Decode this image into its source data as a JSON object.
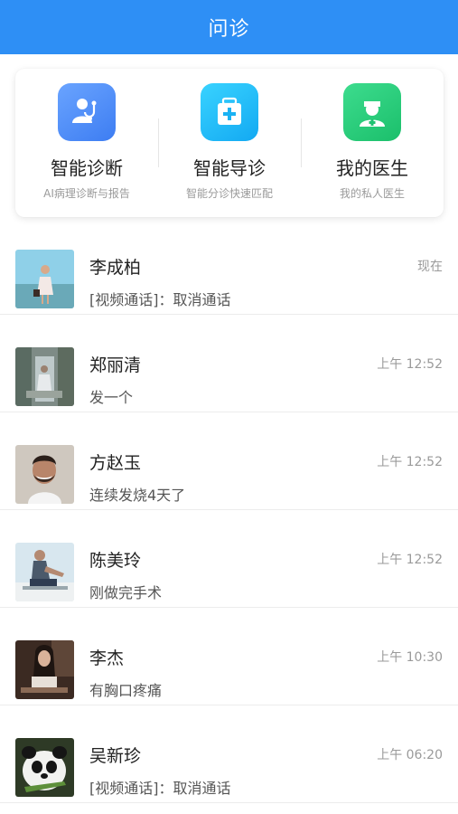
{
  "header": {
    "title": "问诊"
  },
  "services": [
    {
      "name": "智能诊断",
      "desc": "AI病理诊断与报告",
      "icon": "doctor-stethoscope-icon",
      "color": "#4f8ef7"
    },
    {
      "name": "智能导诊",
      "desc": "智能分诊快速匹配",
      "icon": "medical-kit-icon",
      "color": "#22bdf7"
    },
    {
      "name": "我的医生",
      "desc": "我的私人医生",
      "icon": "nurse-icon",
      "color": "#27c97a"
    }
  ],
  "conversations": [
    {
      "name": "李成柏",
      "message": "[视频通话]：取消通话",
      "time": "现在"
    },
    {
      "name": "郑丽清",
      "message": "发一个",
      "time": "上午 12:52"
    },
    {
      "name": "方赵玉",
      "message": "连续发烧4天了",
      "time": "上午 12:52"
    },
    {
      "name": "陈美玲",
      "message": "刚做完手术",
      "time": "上午 12:52"
    },
    {
      "name": "李杰",
      "message": "有胸口疼痛",
      "time": "上午 10:30"
    },
    {
      "name": "吴新珍",
      "message": "[视频通话]：取消通话",
      "time": "上午 06:20"
    }
  ]
}
